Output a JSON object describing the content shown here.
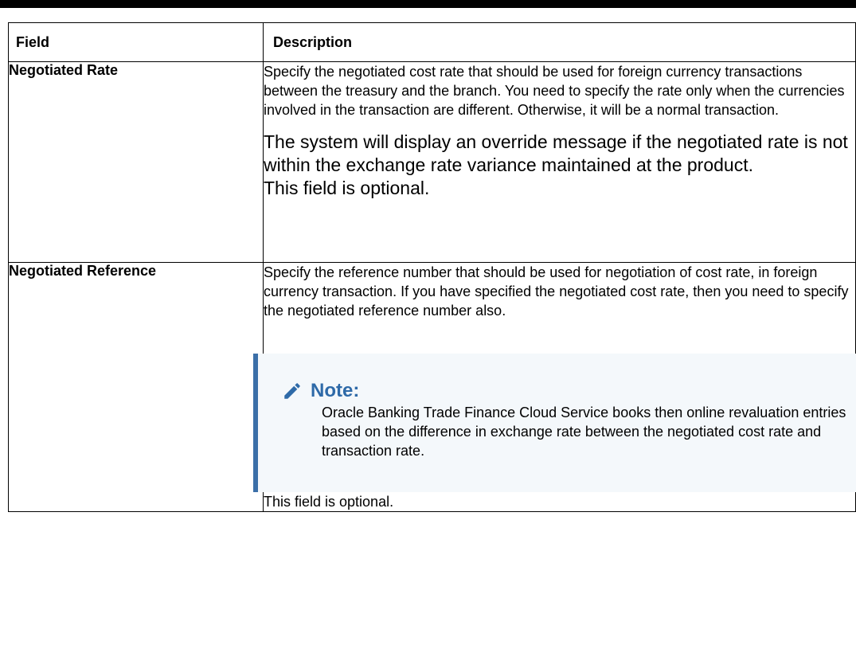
{
  "table": {
    "headers": {
      "field": "Field",
      "description": "Description"
    },
    "rows": [
      {
        "field": "Negotiated Rate",
        "para1": "Specify the negotiated cost rate that should be used for foreign currency transactions between the treasury and the branch. You need to specify the rate only when the currencies involved in the transaction are different. Otherwise, it will be a normal transaction.",
        "para2": "The system will display an override message if the negotiated rate is not within the exchange rate variance maintained at the product.",
        "para3": "This field is optional."
      },
      {
        "field": "Negotiated Reference",
        "para1": "Specify the reference number that should be used for negotiation of cost rate, in foreign currency transaction. If you have specified the negotiated cost rate, then you need to specify the negotiated reference number also.",
        "note": {
          "icon": "pencil-icon",
          "title": "Note:",
          "text": "Oracle Banking Trade Finance Cloud Service books then online revaluation entries based on the difference in exchange rate between the negotiated cost rate and transaction rate."
        },
        "para_after": "This field is optional."
      }
    ]
  },
  "colors": {
    "accent": "#2e6aa8",
    "note_border": "#3b6fa8",
    "note_bg": "#f4f8fb"
  }
}
